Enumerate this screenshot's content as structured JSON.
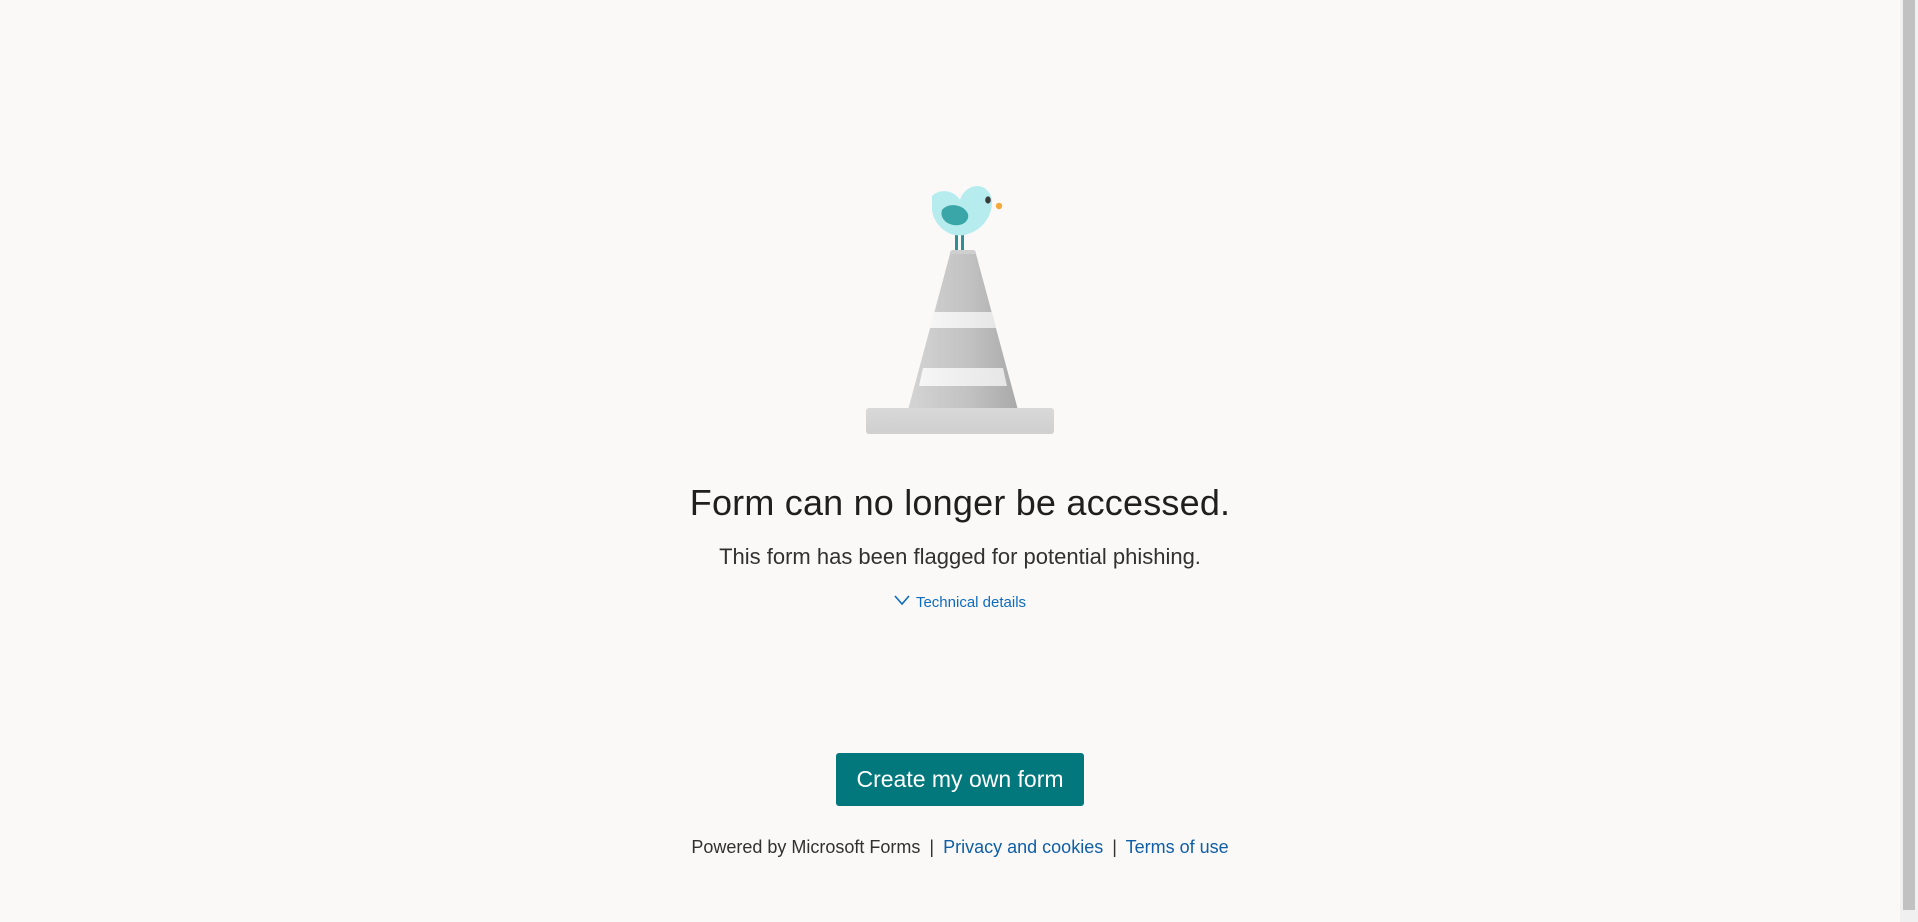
{
  "message": {
    "title": "Form can no longer be accessed.",
    "subtitle": "This form has been flagged for potential phishing.",
    "details_toggle": "Technical details",
    "details_icon": "chevron-down-icon"
  },
  "cta": {
    "label": "Create my own form"
  },
  "footer": {
    "powered_by": "Powered by Microsoft Forms",
    "separator": "|",
    "privacy_link": "Privacy and cookies",
    "terms_link": "Terms of use"
  },
  "colors": {
    "background": "#faf9f8",
    "accent": "#03787c",
    "link": "#0f6cbd",
    "text": "#201f1e"
  },
  "illustration": {
    "icon": "traffic-cone-with-bird-icon"
  }
}
